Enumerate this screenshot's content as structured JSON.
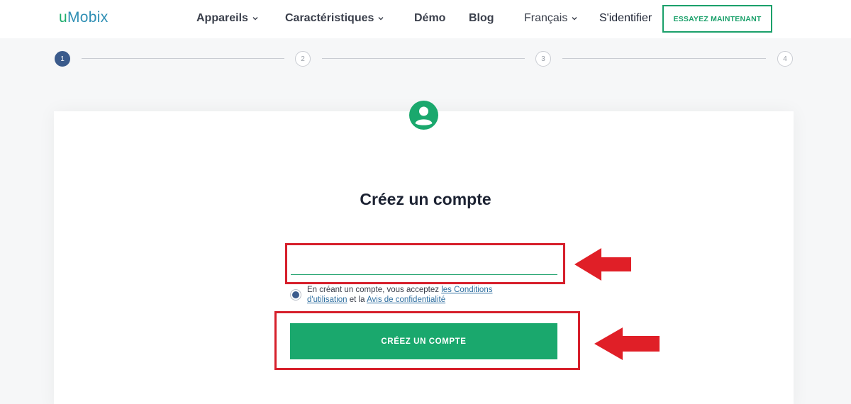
{
  "header": {
    "logo_u": "u",
    "logo_rest": "Mobix",
    "nav": {
      "devices": "Appareils",
      "features": "Caractéristiques",
      "demo": "Démo",
      "blog": "Blog",
      "language": "Français",
      "signin": "S'identifier"
    },
    "cta_label": "ESSAYEZ MAINTENANT"
  },
  "steps": [
    "1",
    "2",
    "3",
    "4"
  ],
  "current_step": 1,
  "form": {
    "icon": "user-circle-icon",
    "title": "Créez un compte",
    "email_value": "",
    "terms_prefix": "En créant un compte, vous acceptez",
    "terms_link": "les Conditions d'utilisation",
    "terms_middle": "et la",
    "privacy_link": "Avis de confidentialité",
    "submit_label": "CRÉEZ UN COMPTE"
  },
  "annotations": {
    "highlight_color": "#d61f2b",
    "arrow_icon": "red-arrow-left-icon"
  },
  "colors": {
    "brand_green": "#1aa86d",
    "step_active": "#3b5b8c",
    "logo_blue": "#2f8fb4"
  }
}
